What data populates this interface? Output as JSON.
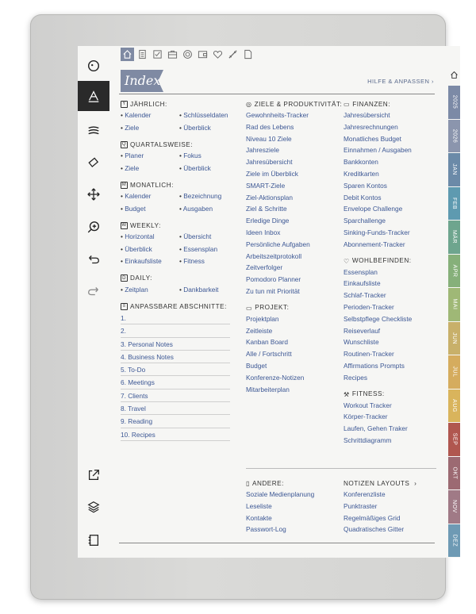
{
  "header": {
    "title": "Index",
    "help": "HILFE & ANPASSEN",
    "top_icons": [
      "home-icon",
      "list-icon",
      "checkbox-icon",
      "briefcase-icon",
      "target-icon",
      "wallet-icon",
      "heart-icon",
      "fitness-icon",
      "page-icon"
    ]
  },
  "rail": {
    "tools": [
      "timer-icon",
      "pen-icon",
      "menu-icon",
      "eraser-icon",
      "move-icon",
      "zoom-icon",
      "undo-icon",
      "redo-icon",
      "share-icon",
      "layers-icon",
      "notebook-icon"
    ]
  },
  "col1": {
    "yearly": {
      "title": "JÄHRLICH:",
      "items": [
        "Kalender",
        "Schlüsseldaten",
        "Ziele",
        "Überblick"
      ]
    },
    "quarterly": {
      "title": "QUARTALSWEISE:",
      "items": [
        "Planer",
        "Fokus",
        "Ziele",
        "Überblick"
      ]
    },
    "monthly": {
      "title": "MONATLICH:",
      "items": [
        "Kalender",
        "Bezeichnung",
        "Budget",
        "Ausgaben"
      ]
    },
    "weekly": {
      "title": "WEEKLY:",
      "items": [
        "Horizontal",
        "Übersicht",
        "Überblick",
        "Essensplan",
        "Einkaufsliste",
        "Fitness"
      ]
    },
    "daily": {
      "title": "DAILY:",
      "items": [
        "Zeitplan",
        "Dankbarkeit"
      ]
    },
    "custom": {
      "title": "ANPASSBARE ABSCHNITTE:",
      "items": [
        "1.",
        "2.",
        "3. Personal Notes",
        "4. Business Notes",
        "5. To-Do",
        "6. Meetings",
        "7. Clients",
        "8. Travel",
        "9. Reading",
        "10. Recipes"
      ]
    }
  },
  "col2": {
    "goals": {
      "title": "ZIELE & PRODUKTIVITÄT:",
      "items": [
        "Gewohnheits-Tracker",
        "Rad des Lebens",
        "Niveau 10 Ziele",
        "Jahresziele",
        "Jahresübersicht",
        "Ziele im Überblick",
        "SMART-Ziele",
        "Ziel-Aktionsplan",
        "Ziel & Schritte",
        "Erledige Dinge",
        "Ideen Inbox",
        "Persönliche Aufgaben",
        "Arbeitszeitprotokoll",
        "Zeitverfolger",
        "Pomodoro Planner",
        "Zu tun mit Priorität"
      ]
    },
    "project": {
      "title": "PROJEKT:",
      "items": [
        "Projektplan",
        "Zeitleiste",
        "Kanban Board",
        "Alle / Fortschritt",
        "Budget",
        "Konferenze-Notizen",
        "Mitarbeiterplan"
      ]
    },
    "other": {
      "title": "ANDERE:",
      "items": [
        "Soziale Medienplanung",
        "Leseliste",
        "Kontakte",
        "Passwort-Log"
      ]
    }
  },
  "col3": {
    "finance": {
      "title": "FINANZEN:",
      "items": [
        "Jahresübersicht",
        "Jahresrechnungen",
        "Monatliches Budget",
        "Einnahmen / Ausgaben",
        "Bankkonten",
        "Kreditkarten",
        "Sparen Kontos",
        "Debit Kontos",
        "Envelope Challenge",
        "Sparchallenge",
        "Sinking-Funds-Tracker",
        "Abonnement-Tracker"
      ]
    },
    "wellbeing": {
      "title": "WOHLBEFINDEN:",
      "items": [
        "Essensplan",
        "Einkaufsliste",
        "Schlaf-Tracker",
        "Perioden-Tracker",
        "Selbstpflege Checkliste",
        "Reiseverlauf",
        "Wunschliste",
        "Routinen-Tracker",
        "Affirmations Prompts",
        "Recipes"
      ]
    },
    "fitness": {
      "title": "FITNESS:",
      "items": [
        "Workout Tracker",
        "Körper-Tracker",
        "Laufen, Gehen Traker",
        "Schrittdiagramm"
      ]
    },
    "notes": {
      "title": "NOTIZEN LAYOUTS",
      "items": [
        "Konferenzliste",
        "Punktraster",
        "Regelmäßiges Grid",
        "Quadratisches Gitter"
      ]
    }
  },
  "tabs": [
    {
      "label": "2025",
      "color": "#7c8aa6"
    },
    {
      "label": "2026",
      "color": "#8b95ad"
    },
    {
      "label": "JAN",
      "color": "#6b8aa8"
    },
    {
      "label": "FEB",
      "color": "#5e9ab0"
    },
    {
      "label": "MÄR",
      "color": "#6ea58e"
    },
    {
      "label": "APR",
      "color": "#86b07a"
    },
    {
      "label": "MAI",
      "color": "#9fb876"
    },
    {
      "label": "JUN",
      "color": "#c8b06a"
    },
    {
      "label": "JUL",
      "color": "#d5ac5e"
    },
    {
      "label": "AUG",
      "color": "#d9b45c"
    },
    {
      "label": "SEP",
      "color": "#b0574f"
    },
    {
      "label": "OKT",
      "color": "#9c6a72"
    },
    {
      "label": "NOV",
      "color": "#a07a86"
    },
    {
      "label": "DEZ",
      "color": "#6e9ab4"
    }
  ]
}
